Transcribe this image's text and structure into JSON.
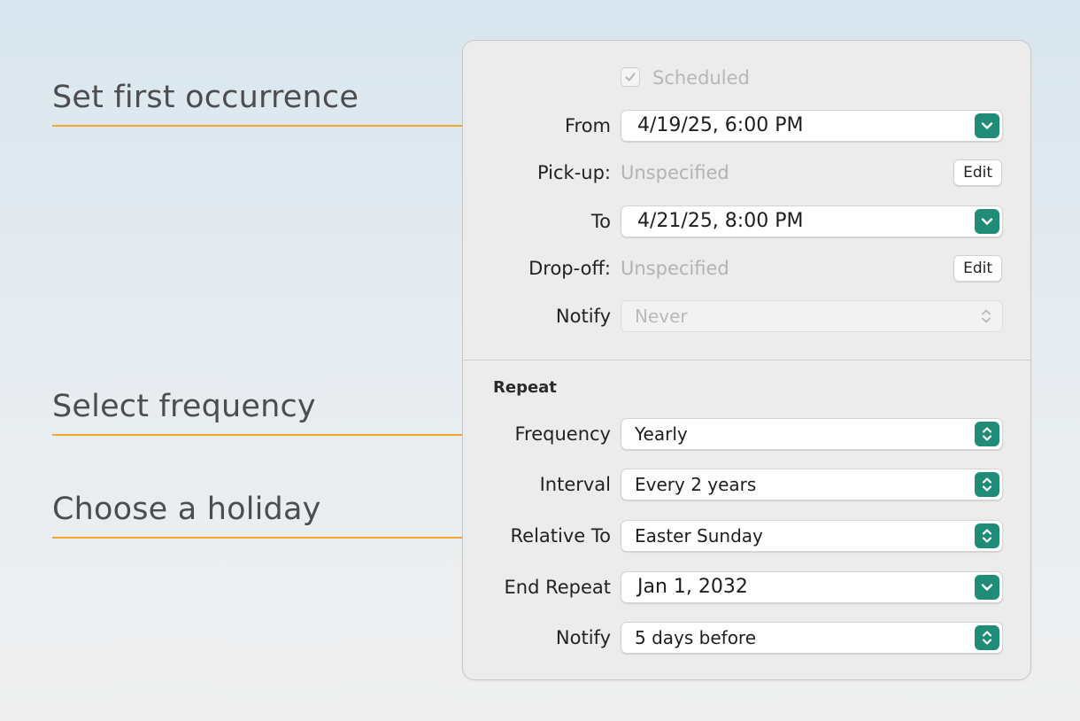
{
  "callouts": {
    "first_occurrence": "Set first occurrence",
    "frequency": "Select frequency",
    "holiday": "Choose a holiday"
  },
  "colors": {
    "accent_line": "#f2a62c",
    "control_teal": "#1f8c78"
  },
  "form": {
    "scheduled": {
      "label": "Scheduled",
      "checked": true,
      "disabled": true
    },
    "from": {
      "label": "From",
      "value": "4/19/25, 6:00 PM",
      "icon": "chevron-down-icon"
    },
    "pickup": {
      "label": "Pick-up:",
      "value": "Unspecified",
      "button": "Edit"
    },
    "to": {
      "label": "To",
      "value": "4/21/25, 8:00 PM",
      "icon": "chevron-down-icon"
    },
    "dropoff": {
      "label": "Drop-off:",
      "value": "Unspecified",
      "button": "Edit"
    },
    "notify": {
      "label": "Notify",
      "value": "Never",
      "disabled": true,
      "icon": "up-down-arrows-icon"
    }
  },
  "repeat": {
    "title": "Repeat",
    "frequency": {
      "label": "Frequency",
      "value": "Yearly",
      "icon": "up-down-arrows-icon"
    },
    "interval": {
      "label": "Interval",
      "value": "Every 2 years",
      "icon": "up-down-arrows-icon"
    },
    "relative_to": {
      "label": "Relative To",
      "value": "Easter Sunday",
      "icon": "up-down-arrows-icon"
    },
    "end_repeat": {
      "label": "End Repeat",
      "value": "Jan 1, 2032",
      "icon": "chevron-down-icon"
    },
    "notify": {
      "label": "Notify",
      "value": "5 days before",
      "icon": "up-down-arrows-icon"
    }
  }
}
